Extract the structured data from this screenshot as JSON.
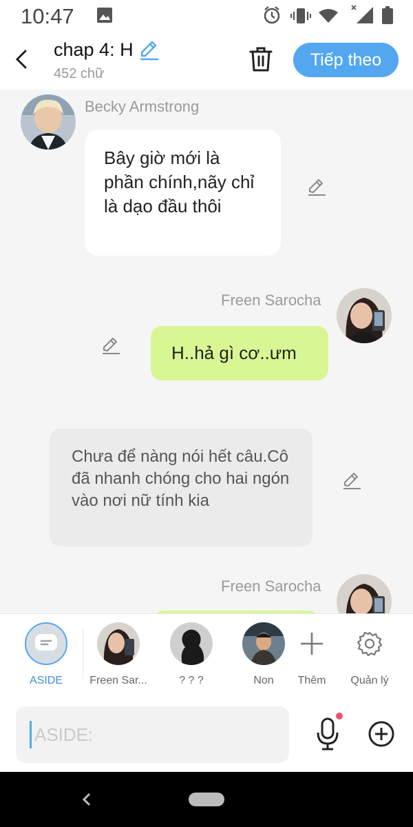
{
  "status_bar": {
    "time": "10:47",
    "icons": [
      "image-icon",
      "alarm-icon",
      "vibrate-icon",
      "wifi-icon",
      "signal-icon",
      "battery-icon"
    ]
  },
  "header": {
    "title": "chap 4: H",
    "word_count": "452 chữ",
    "next_button": "Tiếp theo",
    "accent_color": "#53a7ef"
  },
  "messages": [
    {
      "sender": "Becky Armstrong",
      "side": "left",
      "text": "Bây giờ mới là phần chính,nãy chỉ là dạo đầu thôi"
    },
    {
      "sender": "Freen Sarocha",
      "side": "right",
      "text": "H..hả gì cơ..ưm"
    },
    {
      "type": "aside",
      "text": "Chưa để nàng nói hết câu.Cô đã nhanh chóng cho hai ngón vào nơi nữ tính kia"
    },
    {
      "sender": "Freen Sarocha",
      "side": "right",
      "text": ""
    }
  ],
  "characters": {
    "aside_label": "ASIDE",
    "items": [
      {
        "name": "Freen Sar..."
      },
      {
        "name": "? ? ?"
      },
      {
        "name": "Non"
      }
    ],
    "add_label": "Thêm",
    "manage_label": "Quản lý"
  },
  "composer": {
    "placeholder": "ASIDE:",
    "value": ""
  }
}
